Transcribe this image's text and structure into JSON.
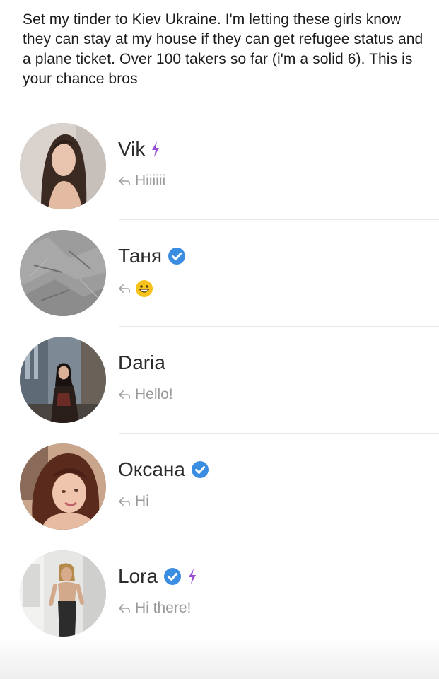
{
  "caption": "Set my tinder to Kiev Ukraine. I'm letting these girls know they can stay at my house if they can get refugee status and a plane ticket. Over 100 takers so far (i'm a solid 6). This is your chance bros",
  "matches": [
    {
      "name": "Vik",
      "verified": false,
      "super_like": true,
      "last_message": "Hiiiiii",
      "emoji_only": false
    },
    {
      "name": "Таня",
      "verified": true,
      "super_like": false,
      "last_message": "",
      "emoji_only": true,
      "emoji": "grinning-face"
    },
    {
      "name": "Daria",
      "verified": false,
      "super_like": false,
      "last_message": "Hello!",
      "emoji_only": false
    },
    {
      "name": "Оксана",
      "verified": true,
      "super_like": false,
      "last_message": "Hi",
      "emoji_only": false
    },
    {
      "name": "Lora",
      "verified": true,
      "super_like": true,
      "last_message": "Hi there!",
      "emoji_only": false
    }
  ],
  "icons": {
    "reply": "reply-arrow-icon",
    "verified": "verified-badge-icon",
    "super_like": "lightning-bolt-icon"
  },
  "colors": {
    "verified_blue": "#3a8de0",
    "bolt_purple": "#9b4fd6",
    "message_gray": "#9a9a9a",
    "divider": "#e8e8e8"
  }
}
